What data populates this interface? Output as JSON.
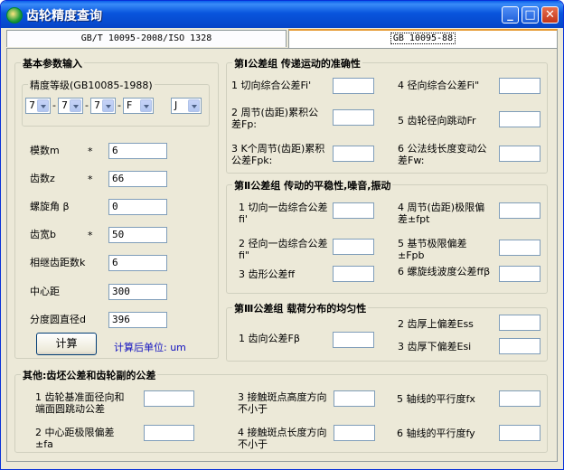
{
  "window": {
    "title": "齿轮精度查询"
  },
  "tabs": [
    "GB/T 10095-2008/ISO 1328",
    "GB 10095-88"
  ],
  "basic": {
    "legend": "基本参数输入",
    "grade_legend": "精度等级(GB10085-1988)",
    "grades": [
      "7",
      "7",
      "7",
      "F",
      "J"
    ],
    "fields": [
      {
        "label": "模数m",
        "req": "*",
        "value": "6"
      },
      {
        "label": "齿数z",
        "req": "*",
        "value": "66"
      },
      {
        "label": "螺旋角 β",
        "req": "",
        "value": "0"
      },
      {
        "label": "齿宽b",
        "req": "*",
        "value": "50"
      },
      {
        "label": "相继齿距数k",
        "req": "",
        "value": "6"
      },
      {
        "label": "中心距",
        "req": "",
        "value": "300"
      },
      {
        "label": "分度圆直径d",
        "req": "",
        "value": "396"
      }
    ],
    "calc_button": "计算",
    "unit_note": "计算后单位: um"
  },
  "g1": {
    "legend": "第Ⅰ公差组    传递运动的准确性",
    "items": [
      "1 切向综合公差Fi'",
      "4 径向综合公差Fi\"",
      "2 周节(齿距)累积公差Fp:",
      "5 齿轮径向跳动Fr",
      "3 K个周节(齿距)累积公差Fpk:",
      "6 公法线长度变动公差Fw:"
    ]
  },
  "g2": {
    "legend": "第Ⅱ公差组    传动的平稳性,噪音,振动",
    "items": [
      "1 切向一齿综合公差fi'",
      "4 周节(齿距)极限偏差±fpt",
      "2 径向一齿综合公差fi\"",
      "5 基节极限偏差±Fpb",
      "3 齿形公差ff",
      "6 螺旋线波度公差ffβ"
    ]
  },
  "g3": {
    "legend": "第Ⅲ公差组    载荷分布的均匀性",
    "items": [
      "1 齿向公差Fβ",
      "2 齿厚上偏差Ess",
      "3 齿厚下偏差Esi"
    ]
  },
  "other": {
    "legend": "其他:齿坯公差和齿轮副的公差",
    "items": [
      "1 齿轮基准面径向和端面圆跳动公差",
      "3 接触斑点高度方向不小于",
      "5 轴线的平行度fx",
      "2 中心距极限偏差±fa",
      "4 接触斑点长度方向不小于",
      "6 轴线的平行度fy"
    ]
  }
}
